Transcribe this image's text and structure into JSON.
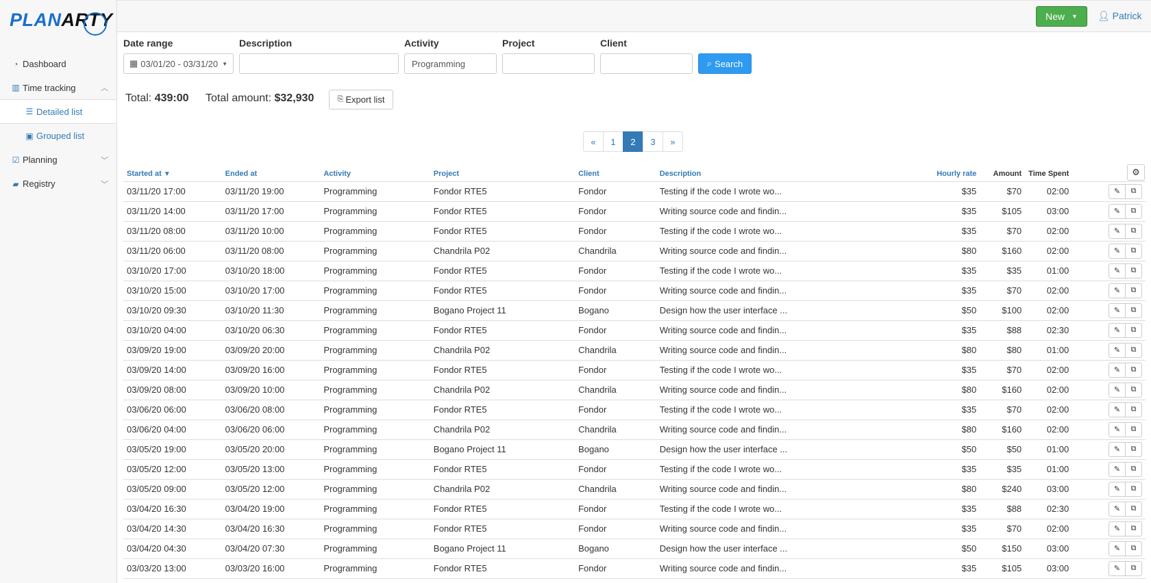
{
  "logo": {
    "part1": "PLAN",
    "part2": "ARTY"
  },
  "sidebar": {
    "items": [
      {
        "label": "Dashboard",
        "icon": "dashboard-icon"
      },
      {
        "label": "Time tracking",
        "icon": "bar-chart-icon"
      },
      {
        "label": "Detailed list",
        "icon": "list-icon"
      },
      {
        "label": "Grouped list",
        "icon": "grouped-list-icon"
      },
      {
        "label": "Planning",
        "icon": "calendar-check-icon"
      },
      {
        "label": "Registry",
        "icon": "book-icon"
      }
    ]
  },
  "topbar": {
    "new_label": "New",
    "user_name": "Patrick"
  },
  "filters": {
    "date_range_label": "Date range",
    "date_range_value": "03/01/20 - 03/31/20",
    "description_label": "Description",
    "description_value": "",
    "activity_label": "Activity",
    "activity_value": "Programming",
    "project_label": "Project",
    "project_value": "",
    "client_label": "Client",
    "client_value": "",
    "search_label": "Search"
  },
  "totals": {
    "total_label": "Total:",
    "total_value": "439:00",
    "amount_label": "Total amount:",
    "amount_value": "$32,930",
    "export_label": "Export list"
  },
  "pager": {
    "prev": "«",
    "pages": [
      "1",
      "2",
      "3"
    ],
    "active": "2",
    "next": "»"
  },
  "table": {
    "headers": {
      "started": "Started at",
      "ended": "Ended at",
      "activity": "Activity",
      "project": "Project",
      "client": "Client",
      "description": "Description",
      "rate": "Hourly rate",
      "amount": "Amount",
      "time": "Time Spent"
    },
    "rows": [
      [
        "03/11/20  17:00",
        "03/11/20  19:00",
        "Programming",
        "Fondor RTE5",
        "Fondor",
        "Testing if the code I wrote wo...",
        "$35",
        "$70",
        "02:00"
      ],
      [
        "03/11/20  14:00",
        "03/11/20  17:00",
        "Programming",
        "Fondor RTE5",
        "Fondor",
        "Writing source code and findin...",
        "$35",
        "$105",
        "03:00"
      ],
      [
        "03/11/20  08:00",
        "03/11/20  10:00",
        "Programming",
        "Fondor RTE5",
        "Fondor",
        "Testing if the code I wrote wo...",
        "$35",
        "$70",
        "02:00"
      ],
      [
        "03/11/20  06:00",
        "03/11/20  08:00",
        "Programming",
        "Chandrila P02",
        "Chandrila",
        "Writing source code and findin...",
        "$80",
        "$160",
        "02:00"
      ],
      [
        "03/10/20  17:00",
        "03/10/20  18:00",
        "Programming",
        "Fondor RTE5",
        "Fondor",
        "Testing if the code I wrote wo...",
        "$35",
        "$35",
        "01:00"
      ],
      [
        "03/10/20  15:00",
        "03/10/20  17:00",
        "Programming",
        "Fondor RTE5",
        "Fondor",
        "Writing source code and findin...",
        "$35",
        "$70",
        "02:00"
      ],
      [
        "03/10/20  09:30",
        "03/10/20  11:30",
        "Programming",
        "Bogano Project 11",
        "Bogano",
        "Design how the user interface ...",
        "$50",
        "$100",
        "02:00"
      ],
      [
        "03/10/20  04:00",
        "03/10/20  06:30",
        "Programming",
        "Fondor RTE5",
        "Fondor",
        "Writing source code and findin...",
        "$35",
        "$88",
        "02:30"
      ],
      [
        "03/09/20  19:00",
        "03/09/20  20:00",
        "Programming",
        "Chandrila P02",
        "Chandrila",
        "Writing source code and findin...",
        "$80",
        "$80",
        "01:00"
      ],
      [
        "03/09/20  14:00",
        "03/09/20  16:00",
        "Programming",
        "Fondor RTE5",
        "Fondor",
        "Testing if the code I wrote wo...",
        "$35",
        "$70",
        "02:00"
      ],
      [
        "03/09/20  08:00",
        "03/09/20  10:00",
        "Programming",
        "Chandrila P02",
        "Chandrila",
        "Writing source code and findin...",
        "$80",
        "$160",
        "02:00"
      ],
      [
        "03/06/20  06:00",
        "03/06/20  08:00",
        "Programming",
        "Fondor RTE5",
        "Fondor",
        "Testing if the code I wrote wo...",
        "$35",
        "$70",
        "02:00"
      ],
      [
        "03/06/20  04:00",
        "03/06/20  06:00",
        "Programming",
        "Chandrila P02",
        "Chandrila",
        "Writing source code and findin...",
        "$80",
        "$160",
        "02:00"
      ],
      [
        "03/05/20  19:00",
        "03/05/20  20:00",
        "Programming",
        "Bogano Project 11",
        "Bogano",
        "Design how the user interface ...",
        "$50",
        "$50",
        "01:00"
      ],
      [
        "03/05/20  12:00",
        "03/05/20  13:00",
        "Programming",
        "Fondor RTE5",
        "Fondor",
        "Testing if the code I wrote wo...",
        "$35",
        "$35",
        "01:00"
      ],
      [
        "03/05/20  09:00",
        "03/05/20  12:00",
        "Programming",
        "Chandrila P02",
        "Chandrila",
        "Writing source code and findin...",
        "$80",
        "$240",
        "03:00"
      ],
      [
        "03/04/20  16:30",
        "03/04/20  19:00",
        "Programming",
        "Fondor RTE5",
        "Fondor",
        "Testing if the code I wrote wo...",
        "$35",
        "$88",
        "02:30"
      ],
      [
        "03/04/20  14:30",
        "03/04/20  16:30",
        "Programming",
        "Fondor RTE5",
        "Fondor",
        "Writing source code and findin...",
        "$35",
        "$70",
        "02:00"
      ],
      [
        "03/04/20  04:30",
        "03/04/20  07:30",
        "Programming",
        "Bogano Project 11",
        "Bogano",
        "Design how the user interface ...",
        "$50",
        "$150",
        "03:00"
      ],
      [
        "03/03/20  13:00",
        "03/03/20  16:00",
        "Programming",
        "Fondor RTE5",
        "Fondor",
        "Writing source code and findin...",
        "$35",
        "$105",
        "03:00"
      ]
    ]
  },
  "colors": {
    "accent": "#337ab7",
    "new_button": "#4cae4c",
    "search_button": "#2e9af0"
  }
}
